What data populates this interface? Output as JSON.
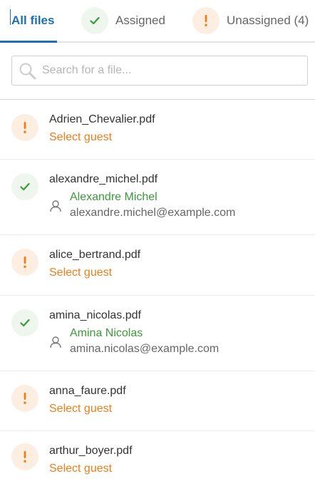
{
  "tabs": {
    "all": "All files",
    "assigned": "Assigned",
    "unassigned": "Unassigned (4)"
  },
  "search": {
    "placeholder": "Search for a file..."
  },
  "files": [
    {
      "name": "Adrien_Chevalier.pdf",
      "status": "unassigned",
      "action": "Select guest"
    },
    {
      "name": "alexandre_michel.pdf",
      "status": "assigned",
      "guest_name": "Alexandre Michel",
      "guest_email": "alexandre.michel@example.com"
    },
    {
      "name": "alice_bertrand.pdf",
      "status": "unassigned",
      "action": "Select guest"
    },
    {
      "name": "amina_nicolas.pdf",
      "status": "assigned",
      "guest_name": "Amina Nicolas",
      "guest_email": "amina.nicolas@example.com"
    },
    {
      "name": "anna_faure.pdf",
      "status": "unassigned",
      "action": "Select guest"
    },
    {
      "name": "arthur_boyer.pdf",
      "status": "unassigned",
      "action": "Select guest"
    }
  ],
  "colors": {
    "accent_blue": "#1f6fb2",
    "assigned_green": "#3a9a3a",
    "unassigned_orange": "#ef7d1a"
  },
  "icons": {
    "assigned": "check-icon",
    "unassigned": "exclamation-icon",
    "search": "search-icon",
    "guest": "person-icon"
  }
}
